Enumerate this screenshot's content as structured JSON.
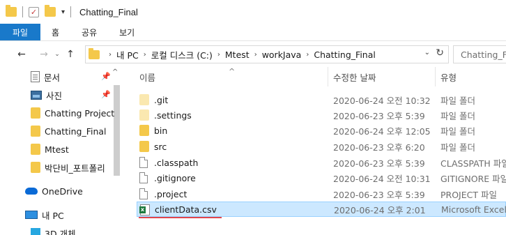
{
  "window": {
    "title": "Chatting_Final",
    "quick_access_dropdown": "▾",
    "check_glyph": "✓"
  },
  "ribbon": {
    "tabs": [
      {
        "label": "파일",
        "active": true
      },
      {
        "label": "홈",
        "active": false
      },
      {
        "label": "공유",
        "active": false
      },
      {
        "label": "보기",
        "active": false
      }
    ]
  },
  "nav": {
    "back": "←",
    "forward": "→",
    "recent": "⌄",
    "up": "↑"
  },
  "address": {
    "crumbs": [
      "내 PC",
      "로컬 디스크 (C:)",
      "Mtest",
      "workJava",
      "Chatting_Final"
    ],
    "separator": "›",
    "dropdown": "⌄",
    "refresh": "↻"
  },
  "search": {
    "placeholder": "Chatting_Fi"
  },
  "navpane": {
    "items": [
      {
        "label": "문서",
        "icon": "document-icon",
        "pinned": true
      },
      {
        "label": "사진",
        "icon": "picture-icon",
        "pinned": true
      },
      {
        "label": "Chatting Project",
        "icon": "folder-icon",
        "pinned": false
      },
      {
        "label": "Chatting_Final",
        "icon": "folder-icon",
        "pinned": false
      },
      {
        "label": "Mtest",
        "icon": "folder-icon",
        "pinned": false
      },
      {
        "label": "박단비_포트폴리",
        "icon": "folder-icon",
        "pinned": false
      },
      {
        "label": "OneDrive",
        "icon": "onedrive-cloud-icon",
        "pinned": false
      },
      {
        "label": "내 PC",
        "icon": "this-pc-icon",
        "pinned": false
      },
      {
        "label": "3D 개체",
        "icon": "3d-objects-icon",
        "pinned": false
      }
    ],
    "pin_glyph": "📌",
    "scroll_up": "^"
  },
  "columns": {
    "name": "이름",
    "date": "수정한 날짜",
    "type": "유형",
    "sort_caret": "^"
  },
  "files": [
    {
      "name": ".git",
      "date": "2020-06-24 오전 10:32",
      "type": "파일 폴더",
      "icon": "hidden-folder-icon",
      "selected": false
    },
    {
      "name": ".settings",
      "date": "2020-06-23 오후 5:39",
      "type": "파일 폴더",
      "icon": "folder-icon",
      "selected": false
    },
    {
      "name": "bin",
      "date": "2020-06-24 오후 12:05",
      "type": "파일 폴더",
      "icon": "folder-icon",
      "selected": false
    },
    {
      "name": "src",
      "date": "2020-06-23 오후 6:20",
      "type": "파일 폴더",
      "icon": "folder-icon",
      "selected": false
    },
    {
      "name": ".classpath",
      "date": "2020-06-23 오후 5:39",
      "type": "CLASSPATH 파일",
      "icon": "file-icon",
      "selected": false
    },
    {
      "name": ".gitignore",
      "date": "2020-06-24 오전 10:31",
      "type": "GITIGNORE 파일",
      "icon": "file-icon",
      "selected": false
    },
    {
      "name": ".project",
      "date": "2020-06-23 오후 5:39",
      "type": "PROJECT 파일",
      "icon": "file-icon",
      "selected": false
    },
    {
      "name": "clientData.csv",
      "date": "2020-06-24 오후 2:01",
      "type": "Microsoft Excel",
      "icon": "excel-csv-icon",
      "selected": true
    }
  ],
  "colors": {
    "accent": "#1979ca",
    "selection": "#cce8ff",
    "selection_border": "#99d1ff",
    "annotation_underline": "#e0474c",
    "folder": "#f4c84a"
  }
}
